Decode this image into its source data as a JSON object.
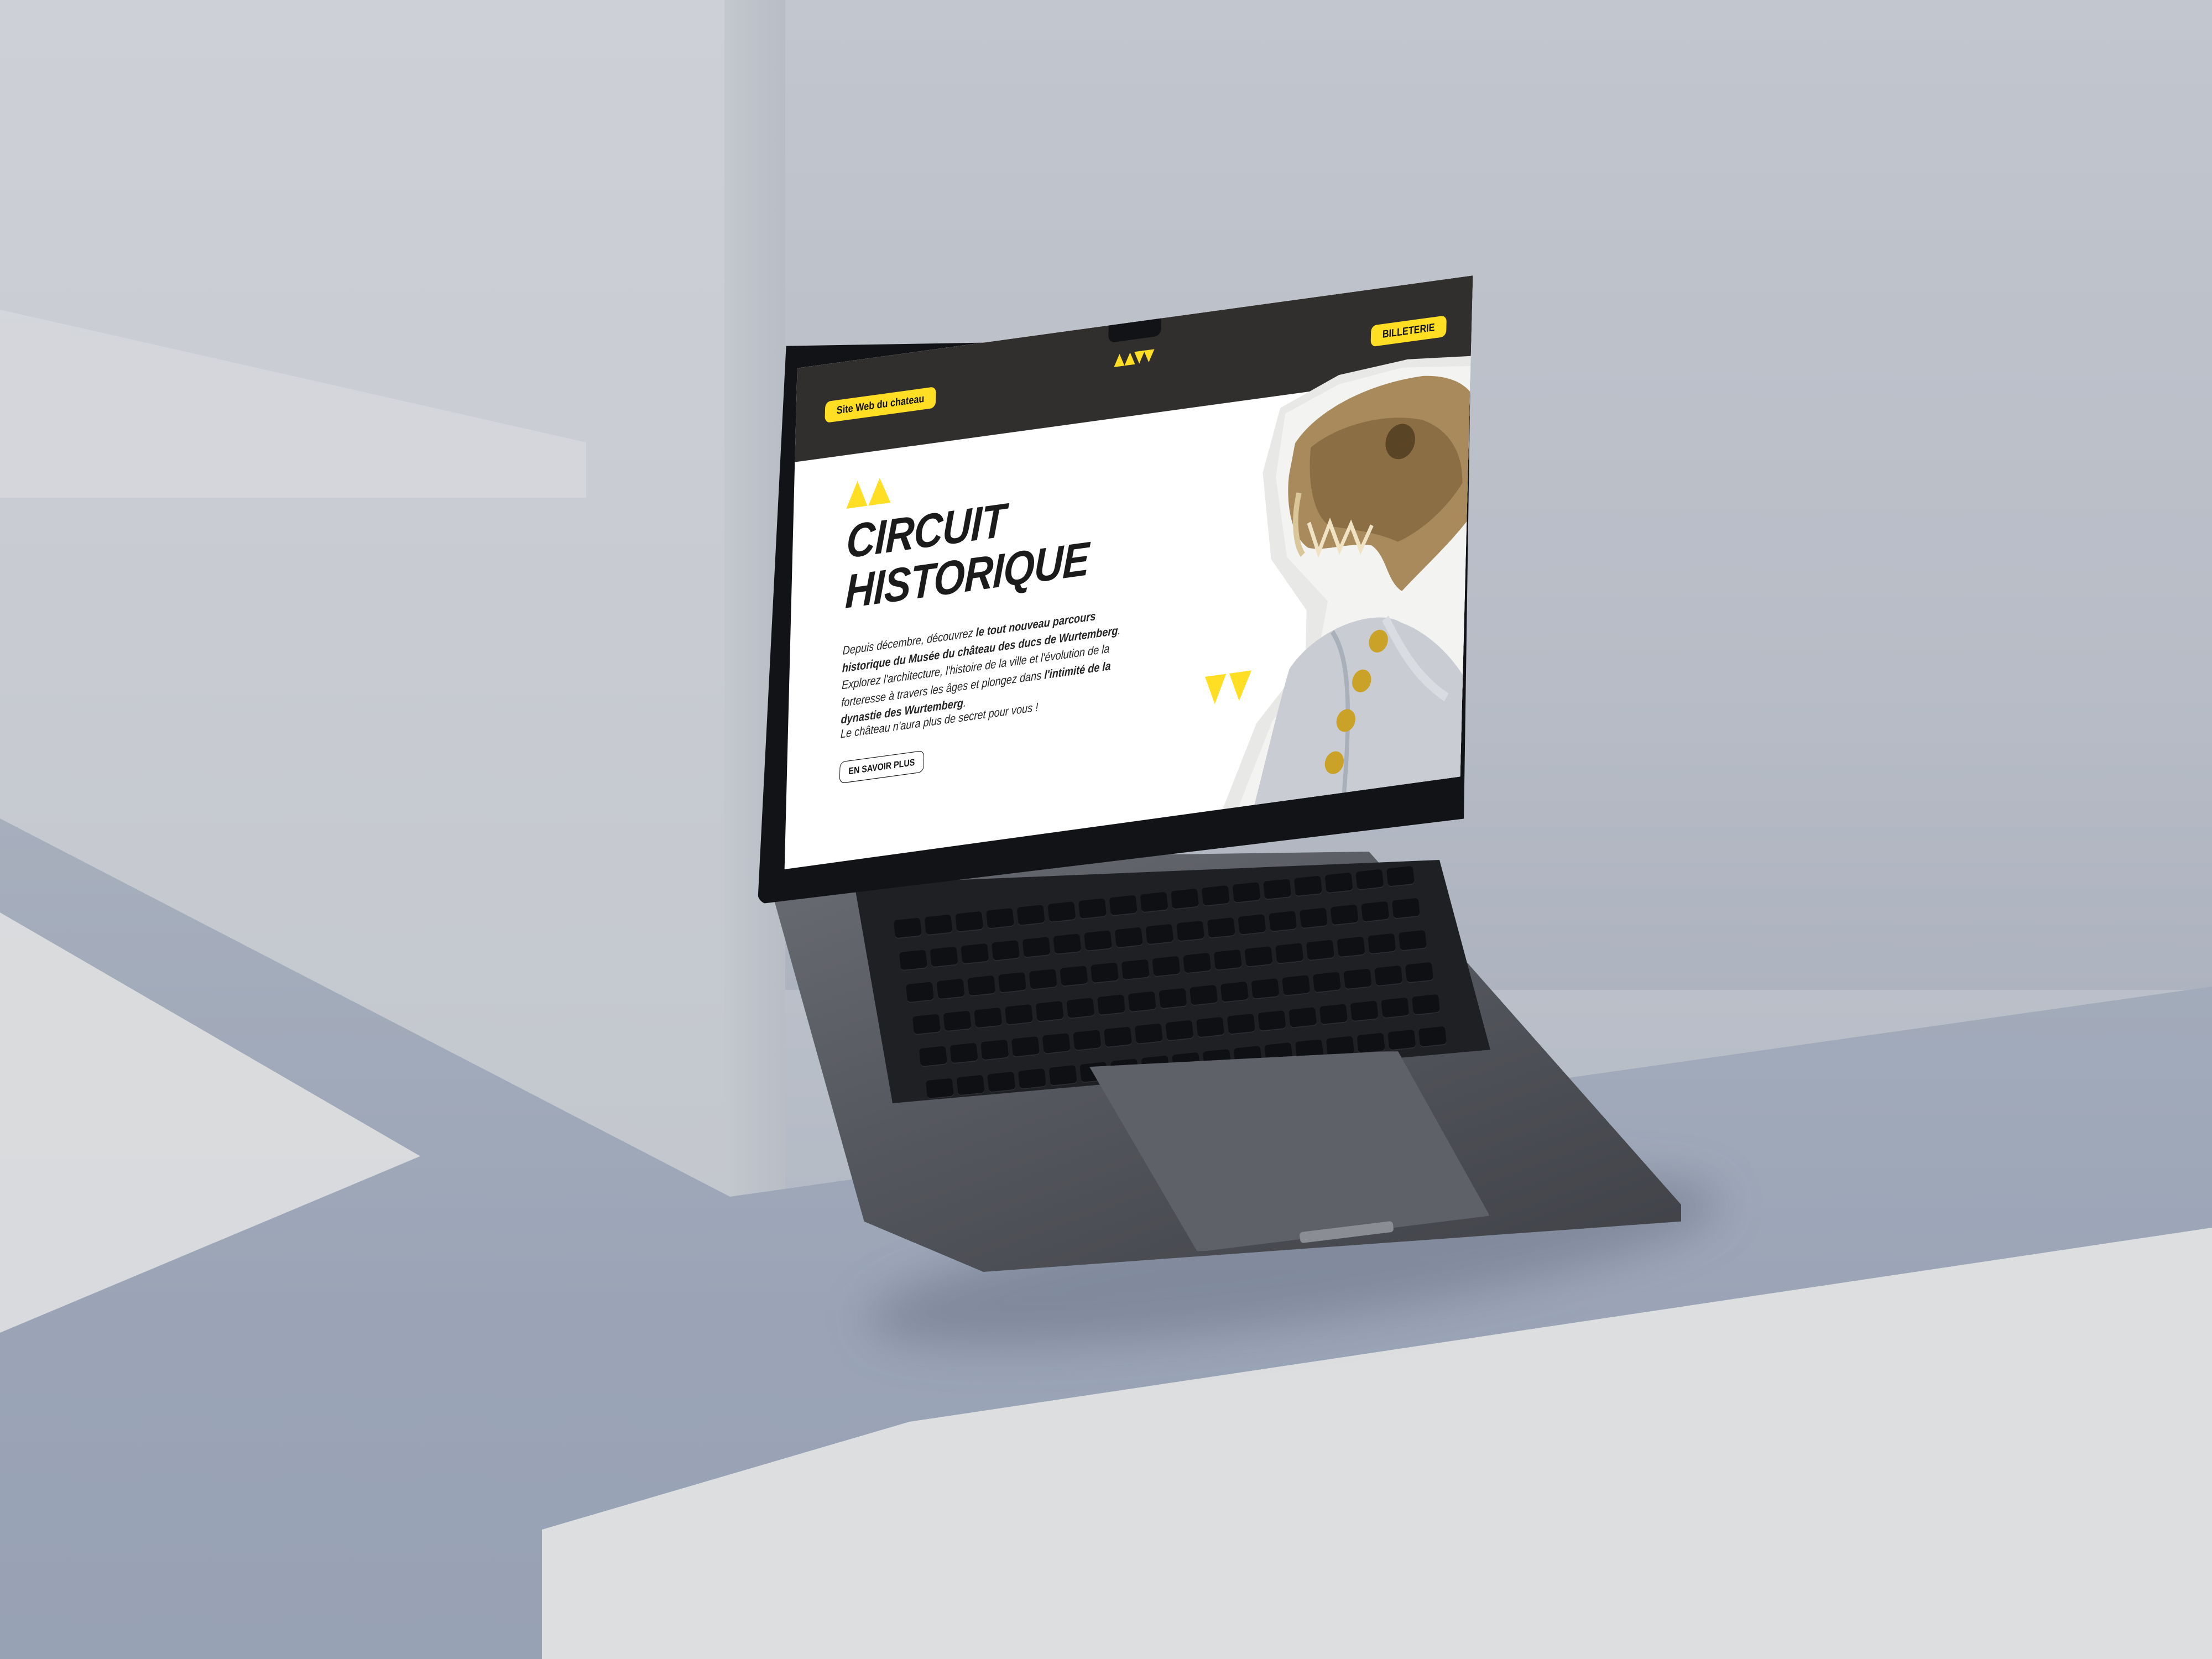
{
  "header": {
    "site_link_label": "Site Web du chateau",
    "ticket_label": "BILLETERIE",
    "logo_icon": "museum-chevrons-logo-icon"
  },
  "hero": {
    "title": "CIRCUIT\nHISTORIQUE",
    "intro_1": "Depuis décembre, découvrez ",
    "intro_bold_1": "le tout nouveau parcours historique du Musée du château des ducs de Wurtemberg",
    "intro_2": ". Explorez l'architecture, l'histoire de la ville et l'évolution de la forteresse à travers les âges et plongez dans ",
    "intro_bold_2": "l'intimité de la dynastie des Wurtemberg",
    "intro_3": ".",
    "tagline": "Le château n'aura plus de secret pour vous !",
    "cta_label": "EN SAVOIR PLUS",
    "decor_icons": [
      "yellow-triangles-top-icon",
      "yellow-triangles-bottom-icon"
    ]
  },
  "collage": {
    "icon": "skull-portrait-collage-icon"
  },
  "colors": {
    "accent_yellow": "#ffde24",
    "header_dark": "#302f2d",
    "text_dark": "#1b1b1b"
  }
}
